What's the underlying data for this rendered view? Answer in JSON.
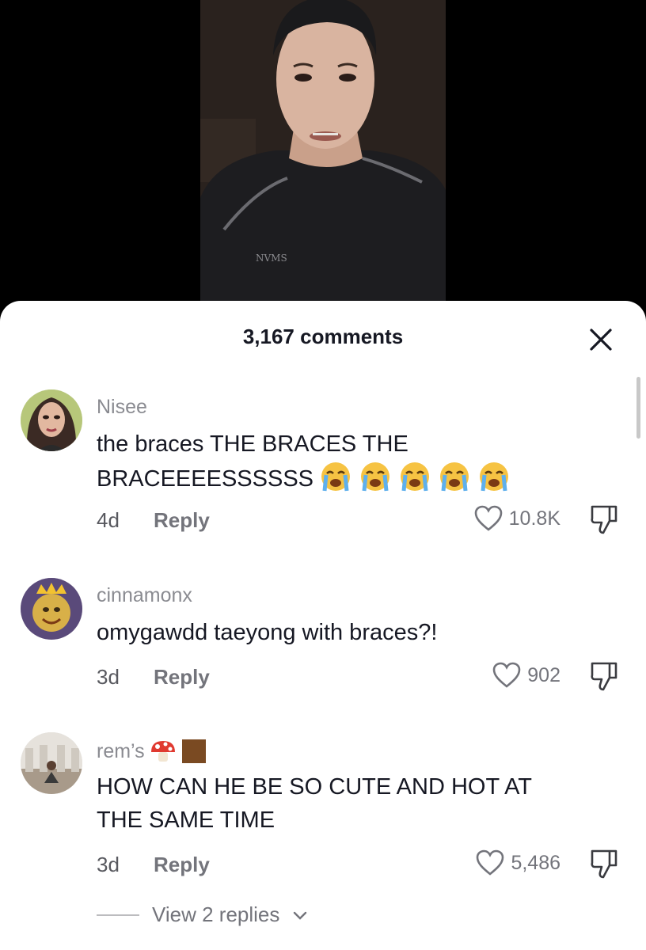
{
  "header": {
    "title": "3,167 comments",
    "close_icon": "close-icon"
  },
  "comments": [
    {
      "username": "Nisee",
      "username_badges": [],
      "text_line1": "the braces THE BRACES THE",
      "text_line2": "BRACEEEESSSSSS",
      "trailing_emoji": [
        "loudly-crying-face",
        "loudly-crying-face",
        "loudly-crying-face",
        "loudly-crying-face",
        "loudly-crying-face"
      ],
      "age": "4d",
      "reply_label": "Reply",
      "likes": "10.8K"
    },
    {
      "username": "cinnamonx",
      "username_badges": [],
      "text_line1": "omygawdd taeyong with braces?!",
      "text_line2": "",
      "trailing_emoji": [],
      "age": "3d",
      "reply_label": "Reply",
      "likes": "902"
    },
    {
      "username": "rem’s",
      "username_badges": [
        "mushroom-emoji",
        "brown-square-emoji"
      ],
      "text_line1": "HOW CAN HE BE SO CUTE AND HOT AT",
      "text_line2": "THE SAME TIME",
      "trailing_emoji": [],
      "age": "3d",
      "reply_label": "Reply",
      "likes": "5,486",
      "view_replies": "View 2 replies"
    }
  ],
  "colors": {
    "text_primary": "#161823",
    "text_secondary": "#8a8b91",
    "meta": "#73747b",
    "sheet_bg": "#ffffff"
  }
}
